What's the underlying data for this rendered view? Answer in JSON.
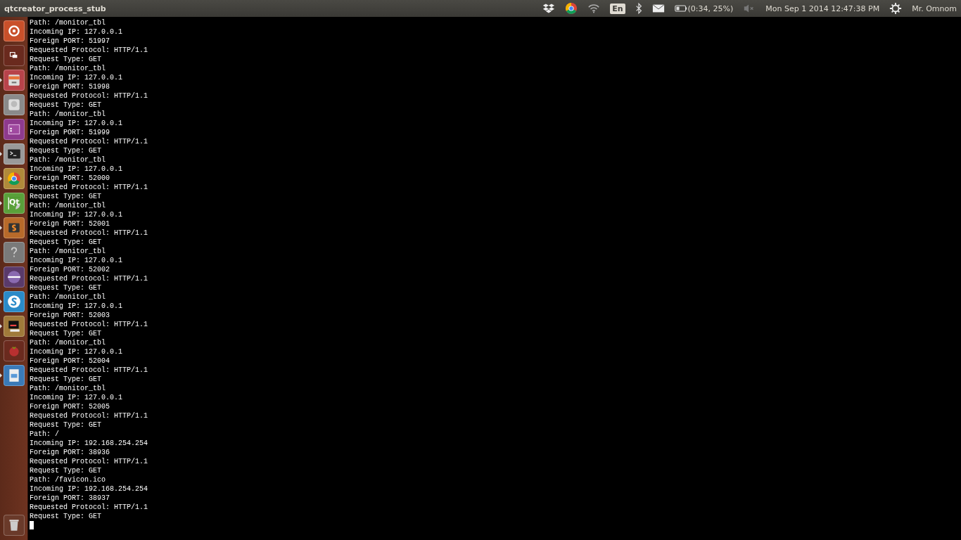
{
  "top_bar": {
    "title": "qtcreator_process_stub",
    "keyboard": "En",
    "battery": "(0:34, 25%)",
    "volume_muted": true,
    "clock": "Mon Sep  1 2014 12:47:38 PM",
    "user": "Mr. Omnom"
  },
  "launcher": [
    {
      "kind": "dash",
      "running": false
    },
    {
      "kind": "workspaces",
      "running": false
    },
    {
      "kind": "files",
      "running": true
    },
    {
      "kind": "disk",
      "running": false
    },
    {
      "kind": "window",
      "running": false
    },
    {
      "kind": "terminal",
      "running": true
    },
    {
      "kind": "chrome",
      "running": true
    },
    {
      "kind": "qt",
      "running": true,
      "label": "Qt"
    },
    {
      "kind": "editor",
      "running": true
    },
    {
      "kind": "help",
      "running": false
    },
    {
      "kind": "eclipse",
      "running": false
    },
    {
      "kind": "skype",
      "running": true
    },
    {
      "kind": "xterm",
      "running": true
    },
    {
      "kind": "tomato",
      "running": false
    },
    {
      "kind": "image",
      "running": true
    }
  ],
  "trash": {
    "kind": "trash",
    "running": false
  },
  "terminal": {
    "cursor": true,
    "lines": [
      "Path: /monitor_tbl",
      "Incoming IP: 127.0.0.1",
      "Foreign PORT: 51997",
      "Requested Protocol: HTTP/1.1",
      "Request Type: GET",
      "Path: /monitor_tbl",
      "Incoming IP: 127.0.0.1",
      "Foreign PORT: 51998",
      "Requested Protocol: HTTP/1.1",
      "Request Type: GET",
      "Path: /monitor_tbl",
      "Incoming IP: 127.0.0.1",
      "Foreign PORT: 51999",
      "Requested Protocol: HTTP/1.1",
      "Request Type: GET",
      "Path: /monitor_tbl",
      "Incoming IP: 127.0.0.1",
      "Foreign PORT: 52000",
      "Requested Protocol: HTTP/1.1",
      "Request Type: GET",
      "Path: /monitor_tbl",
      "Incoming IP: 127.0.0.1",
      "Foreign PORT: 52001",
      "Requested Protocol: HTTP/1.1",
      "Request Type: GET",
      "Path: /monitor_tbl",
      "Incoming IP: 127.0.0.1",
      "Foreign PORT: 52002",
      "Requested Protocol: HTTP/1.1",
      "Request Type: GET",
      "Path: /monitor_tbl",
      "Incoming IP: 127.0.0.1",
      "Foreign PORT: 52003",
      "Requested Protocol: HTTP/1.1",
      "Request Type: GET",
      "Path: /monitor_tbl",
      "Incoming IP: 127.0.0.1",
      "Foreign PORT: 52004",
      "Requested Protocol: HTTP/1.1",
      "Request Type: GET",
      "Path: /monitor_tbl",
      "Incoming IP: 127.0.0.1",
      "Foreign PORT: 52005",
      "Requested Protocol: HTTP/1.1",
      "Request Type: GET",
      "Path: /",
      "Incoming IP: 192.168.254.254",
      "Foreign PORT: 38936",
      "Requested Protocol: HTTP/1.1",
      "Request Type: GET",
      "Path: /favicon.ico",
      "Incoming IP: 192.168.254.254",
      "Foreign PORT: 38937",
      "Requested Protocol: HTTP/1.1",
      "Request Type: GET"
    ]
  }
}
